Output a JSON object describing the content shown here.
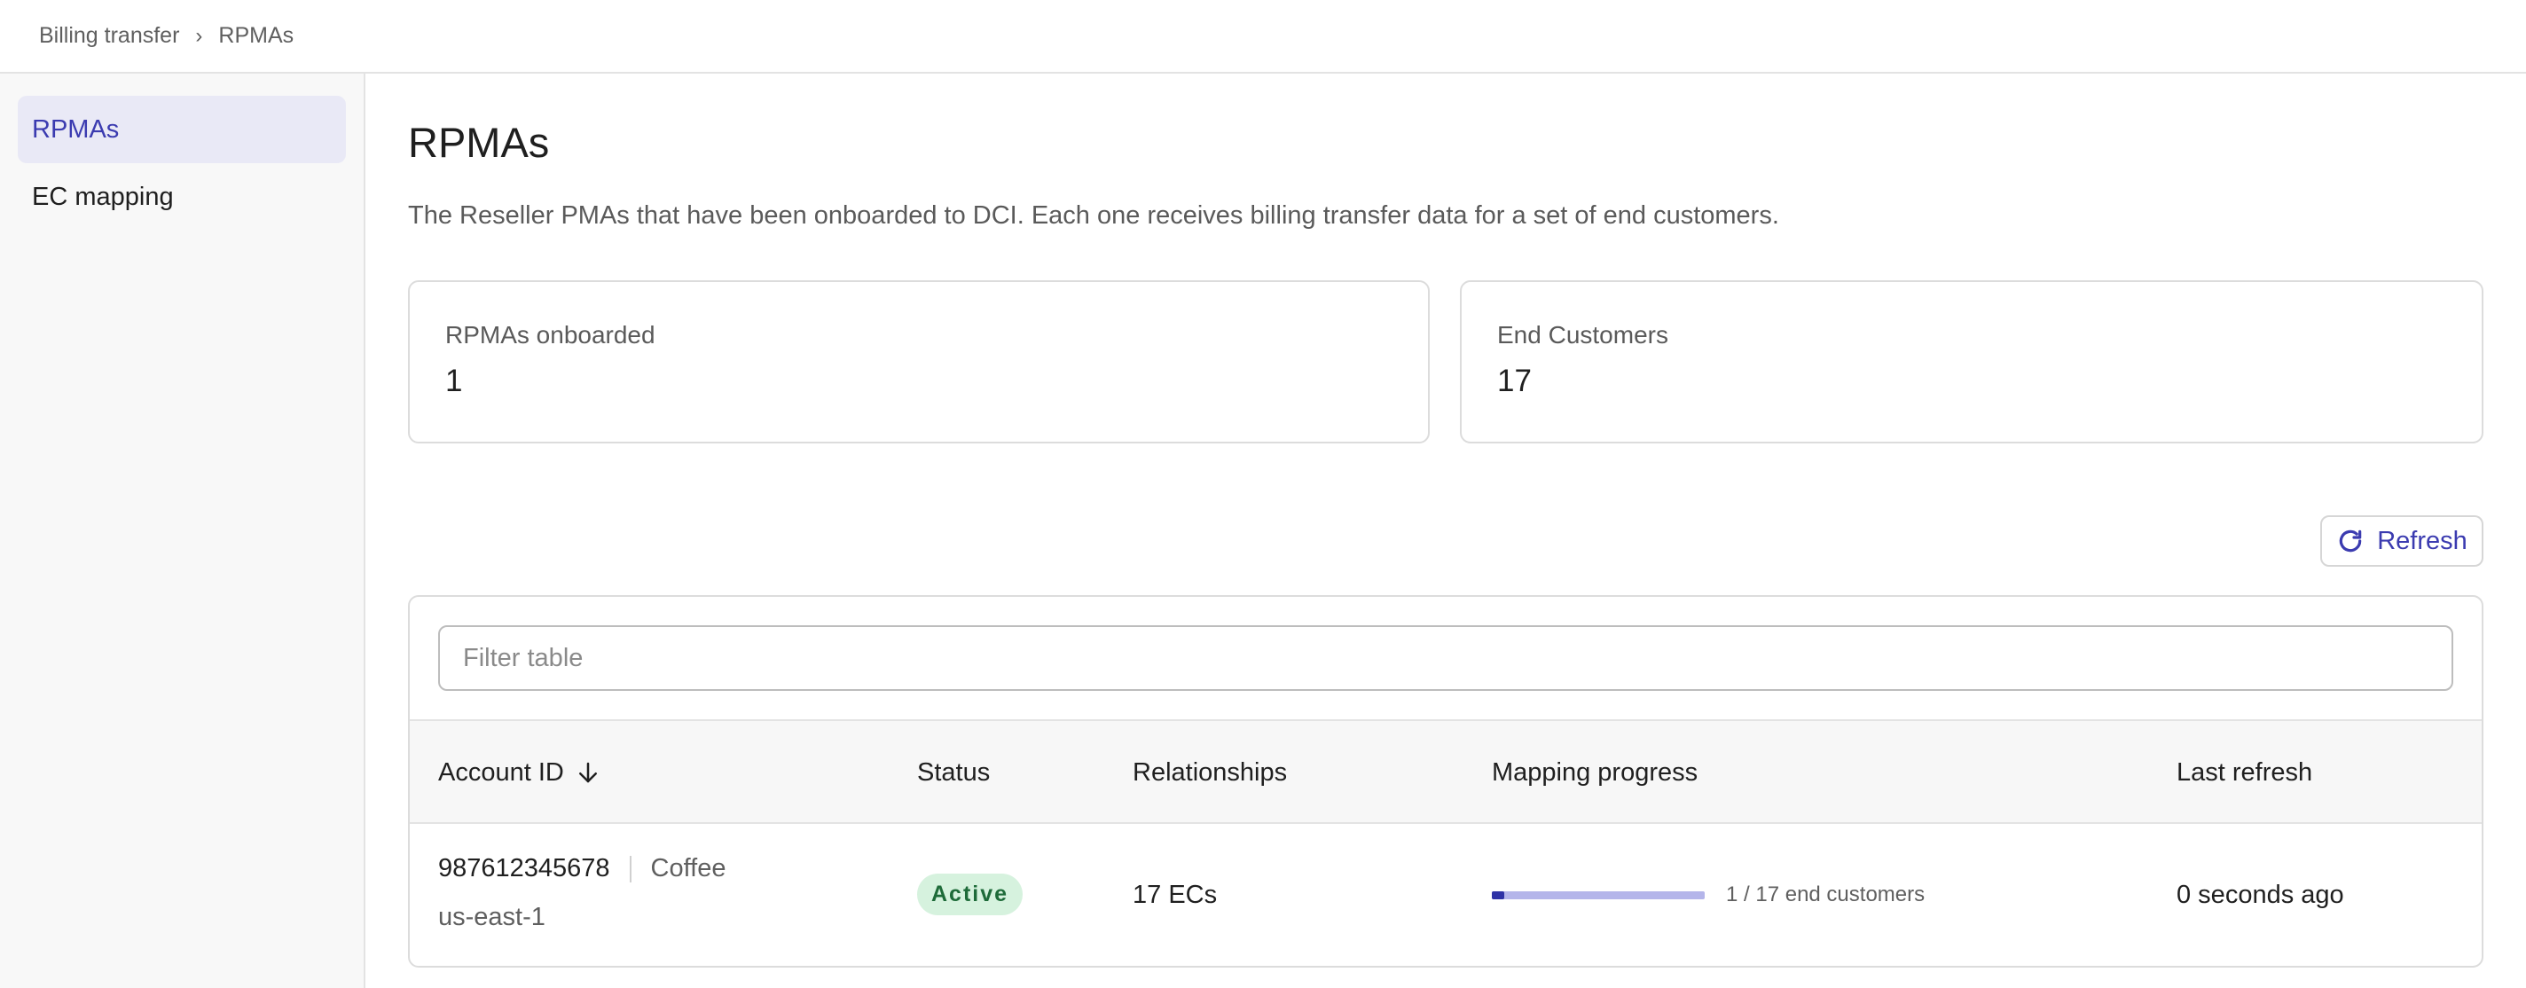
{
  "breadcrumb": {
    "parent": "Billing transfer",
    "separator": "›",
    "current": "RPMAs"
  },
  "sidebar": {
    "items": [
      {
        "label": "RPMAs",
        "active": true
      },
      {
        "label": "EC mapping",
        "active": false
      }
    ]
  },
  "page": {
    "title": "RPMAs",
    "description": "The Reseller PMAs that have been onboarded to DCI. Each one receives billing transfer data for a set of end customers."
  },
  "stats": [
    {
      "label": "RPMAs onboarded",
      "value": "1"
    },
    {
      "label": "End Customers",
      "value": "17"
    }
  ],
  "refresh": {
    "label": "Refresh",
    "icon": "refresh-icon"
  },
  "table": {
    "filter_placeholder": "Filter table",
    "columns": [
      "Account ID",
      "Status",
      "Relationships",
      "Mapping progress",
      "Last refresh"
    ],
    "sort": {
      "column": "Account ID",
      "direction": "descending",
      "icon": "arrow-down-icon"
    },
    "rows": [
      {
        "account_id": "987612345678",
        "account_name": "Coffee",
        "region": "us-east-1",
        "status": "Active",
        "relationships": "17 ECs",
        "mapping_progress": {
          "mapped": 1,
          "total": 17,
          "label": "1 / 17 end customers"
        },
        "last_refresh": "0 seconds ago"
      }
    ]
  },
  "colors": {
    "accent": "#3b3bb0",
    "nav_active_bg": "#e9e9f6",
    "badge_bg": "#d6f2de",
    "badge_text": "#1e6b39",
    "progress_fill": "#2f33a6",
    "progress_track": "#b4b5ea"
  }
}
